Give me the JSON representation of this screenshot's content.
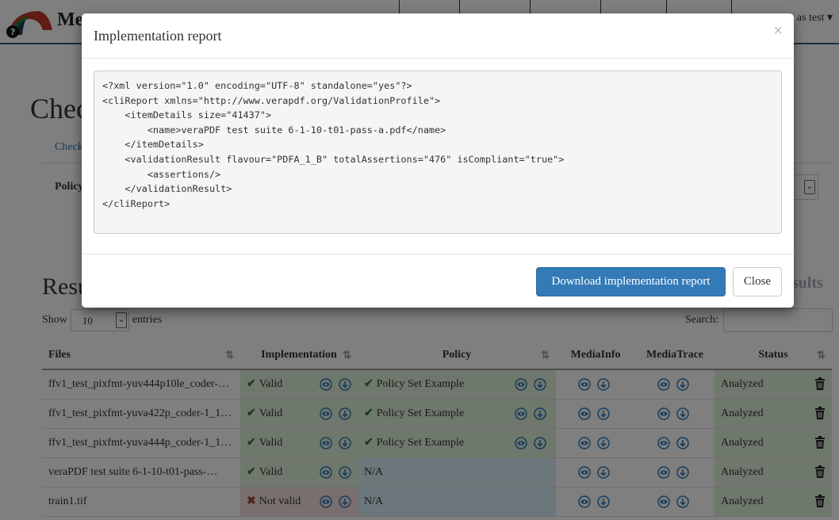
{
  "navbar": {
    "brand": "Me",
    "user_label": "as test",
    "user_caret": "▾"
  },
  "page": {
    "title": "Chec",
    "tab_checker": "Check",
    "policy_label": "Policy",
    "results_title": "Resu",
    "results_right": "esults"
  },
  "table_controls": {
    "show_label": "Show",
    "entries_value": "10",
    "entries_label": "entries",
    "search_label": "Search:"
  },
  "columns": [
    {
      "label": "Files",
      "sortable": true
    },
    {
      "label": "Implementation",
      "sortable": true
    },
    {
      "label": "Policy",
      "sortable": true
    },
    {
      "label": "MediaInfo",
      "sortable": false
    },
    {
      "label": "MediaTrace",
      "sortable": false
    },
    {
      "label": "Status",
      "sortable": true
    }
  ],
  "rows": [
    {
      "file": "ffv1_test_pixfmt-yuv444p10le_coder-…",
      "impl": "Valid",
      "impl_ok": true,
      "policy": "Policy Set Example",
      "policy_state": "ok",
      "status": "Analyzed"
    },
    {
      "file": "ffv1_test_pixfmt-yuva422p_coder-1_1…",
      "impl": "Valid",
      "impl_ok": true,
      "policy": "Policy Set Example",
      "policy_state": "ok",
      "status": "Analyzed"
    },
    {
      "file": "ffv1_test_pixfmt-yuva444p_coder-1_1…",
      "impl": "Valid",
      "impl_ok": true,
      "policy": "Policy Set Example",
      "policy_state": "ok",
      "status": "Analyzed"
    },
    {
      "file": "veraPDF test suite 6-1-10-t01-pass-…",
      "impl": "Valid",
      "impl_ok": true,
      "policy": "N/A",
      "policy_state": "na",
      "status": "Analyzed"
    },
    {
      "file": "train1.tif",
      "impl": "Not valid",
      "impl_ok": false,
      "policy": "N/A",
      "policy_state": "na",
      "status": "Analyzed"
    }
  ],
  "icons": {
    "view": "eye-icon",
    "download": "download-icon",
    "delete": "trash-icon",
    "valid": "check-icon",
    "invalid": "cross-icon",
    "sort": "sort-icon"
  },
  "colors": {
    "primary": "#337ab7",
    "success_bg": "#dff0d8",
    "danger_bg": "#f2dede",
    "info_bg": "#d9edf7",
    "navbar_border": "#2c5f8a"
  },
  "modal": {
    "title": "Implementation report",
    "close_glyph": "×",
    "xml": "<?xml version=\"1.0\" encoding=\"UTF-8\" standalone=\"yes\"?>\n<cliReport xmlns=\"http://www.verapdf.org/ValidationProfile\">\n    <itemDetails size=\"41437\">\n        <name>veraPDF test suite 6-1-10-t01-pass-a.pdf</name>\n    </itemDetails>\n    <validationResult flavour=\"PDFA_1_B\" totalAssertions=\"476\" isCompliant=\"true\">\n        <assertions/>\n    </validationResult>\n</cliReport>",
    "download_label": "Download implementation report",
    "close_label": "Close"
  }
}
